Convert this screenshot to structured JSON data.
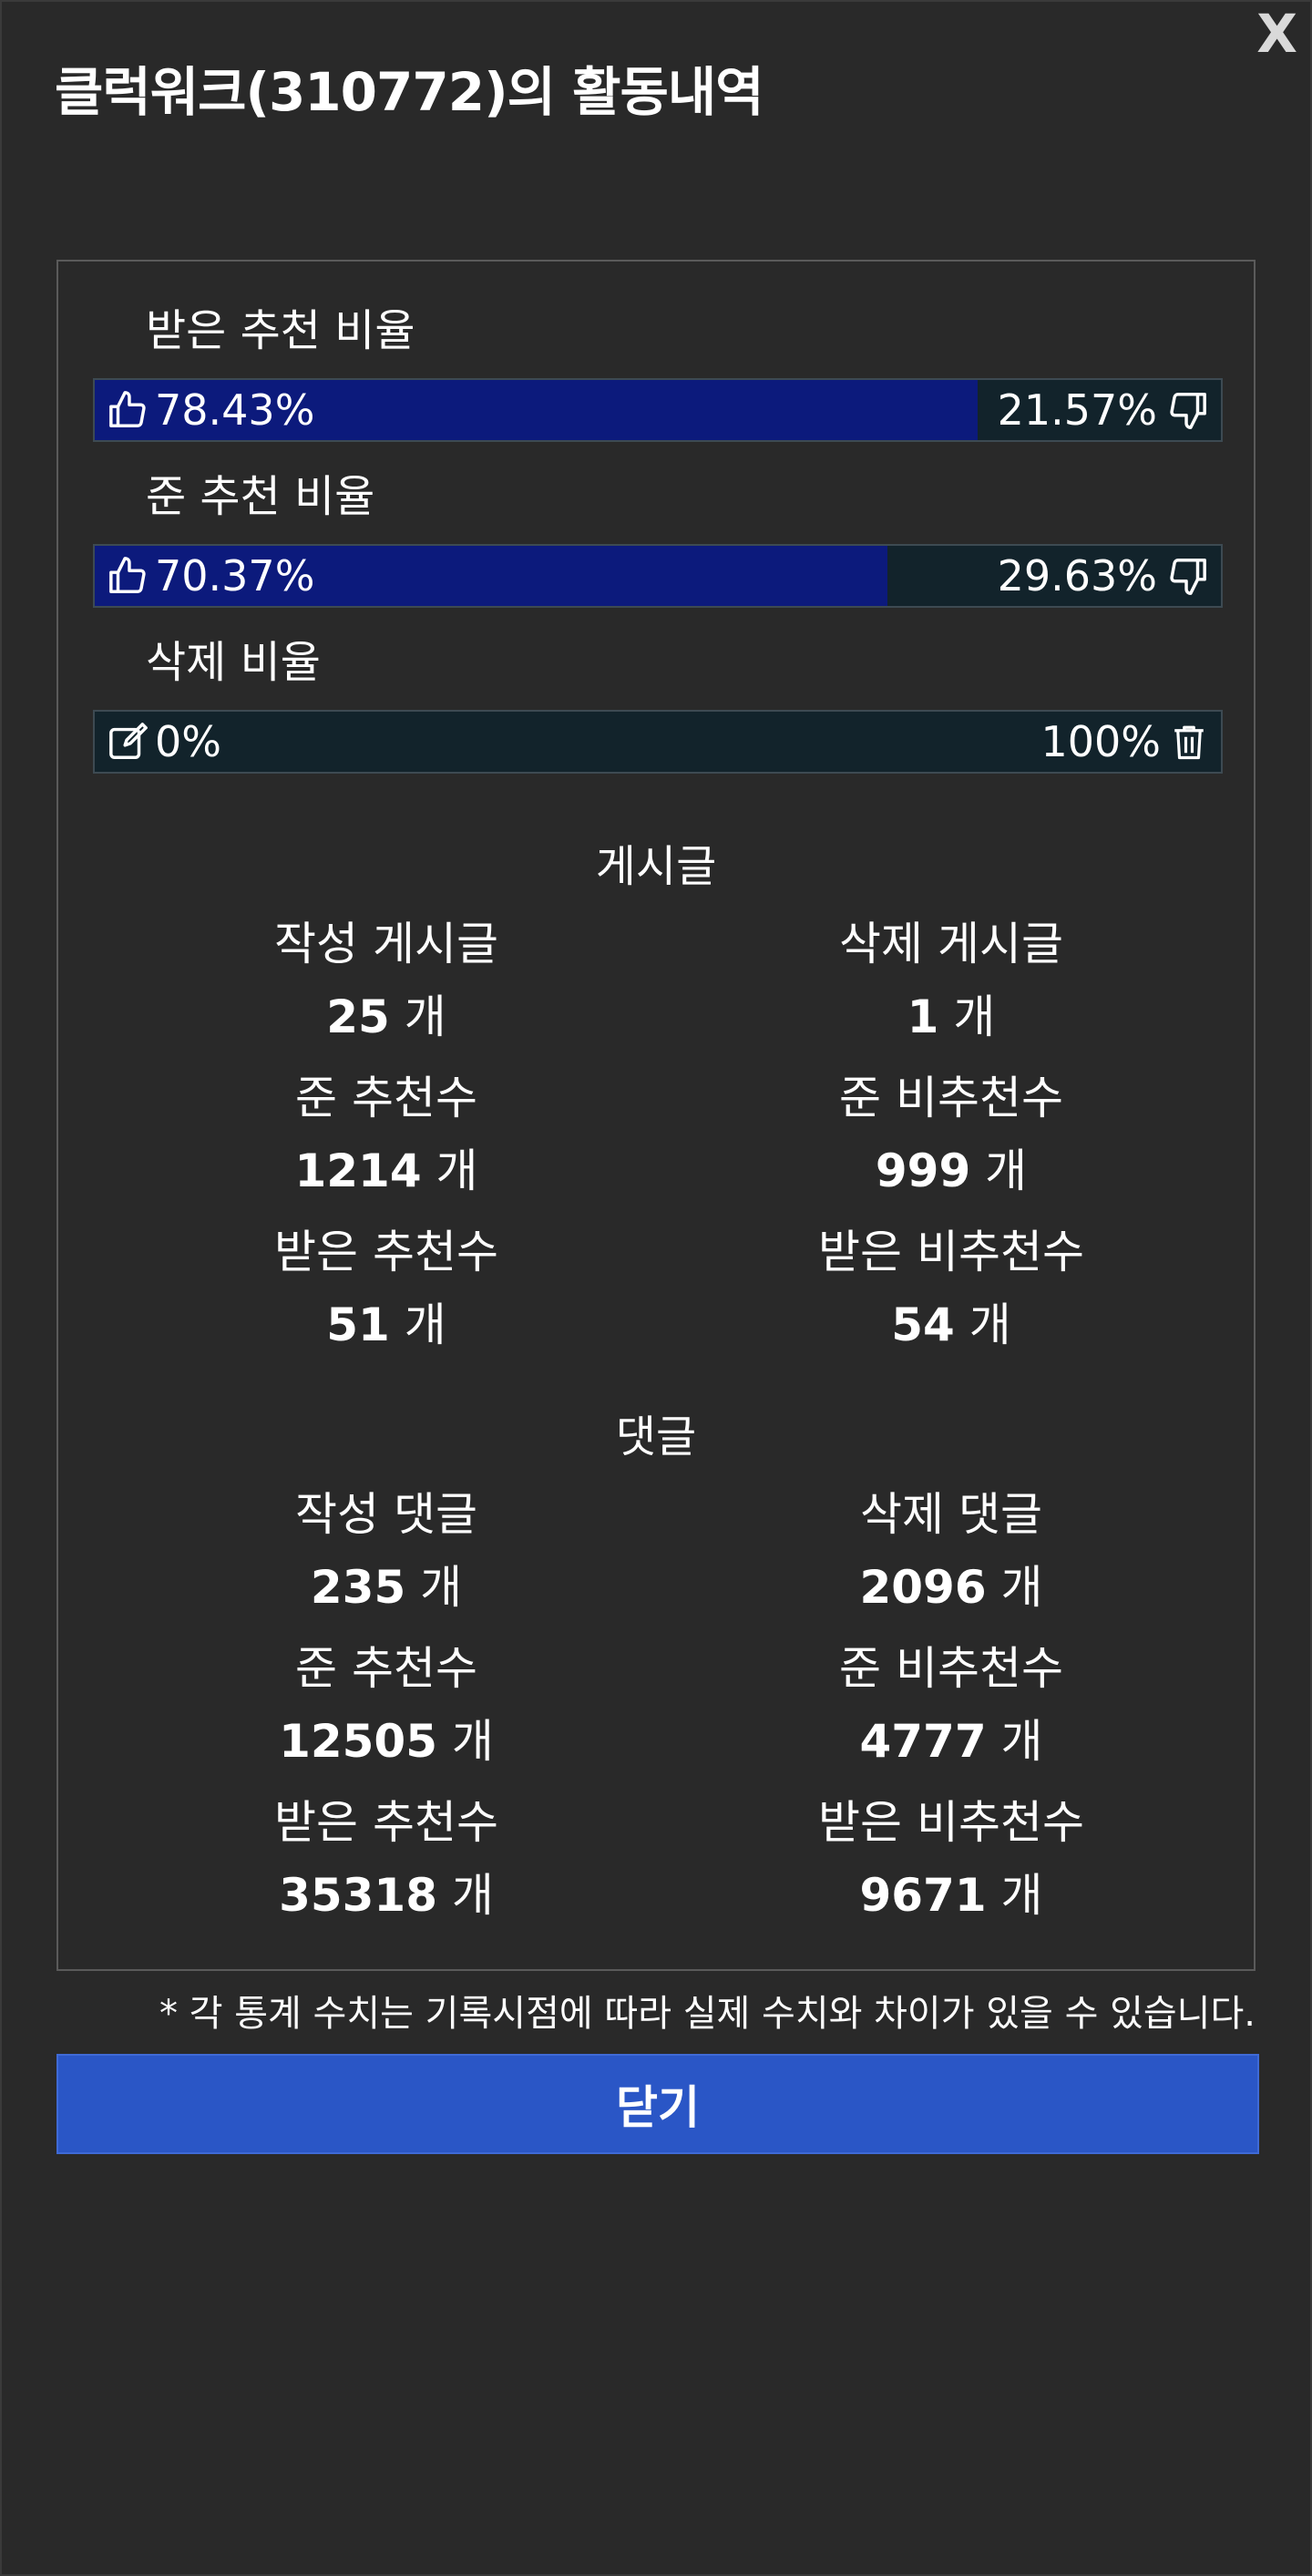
{
  "modal": {
    "title": "클럭워크(310772)의 활동내역",
    "close_x": "X"
  },
  "ratios": [
    {
      "label": "받은 추천 비율",
      "left_icon": "thumbs-up-icon",
      "left_value": "78.43%",
      "right_value": "21.57%",
      "right_icon": "thumbs-down-icon",
      "fill_fraction": 0.7843
    },
    {
      "label": "준 추천 비율",
      "left_icon": "thumbs-up-icon",
      "left_value": "70.37%",
      "right_value": "29.63%",
      "right_icon": "thumbs-down-icon",
      "fill_fraction": 0.7037
    },
    {
      "label": "삭제 비율",
      "left_icon": "edit-icon",
      "left_value": "0%",
      "right_value": "100%",
      "right_icon": "trash-icon",
      "fill_fraction": 0
    }
  ],
  "posts": {
    "title": "게시글",
    "stats": [
      {
        "label": "작성 게시글",
        "value": "25",
        "unit": "개"
      },
      {
        "label": "삭제 게시글",
        "value": "1",
        "unit": "개"
      },
      {
        "label": "준 추천수",
        "value": "1214",
        "unit": "개"
      },
      {
        "label": "준 비추천수",
        "value": "999",
        "unit": "개"
      },
      {
        "label": "받은 추천수",
        "value": "51",
        "unit": "개"
      },
      {
        "label": "받은 비추천수",
        "value": "54",
        "unit": "개"
      }
    ]
  },
  "comments": {
    "title": "댓글",
    "stats": [
      {
        "label": "작성 댓글",
        "value": "235",
        "unit": "개"
      },
      {
        "label": "삭제 댓글",
        "value": "2096",
        "unit": "개"
      },
      {
        "label": "준 추천수",
        "value": "12505",
        "unit": "개"
      },
      {
        "label": "준 비추천수",
        "value": "4777",
        "unit": "개"
      },
      {
        "label": "받은 추천수",
        "value": "35318",
        "unit": "개"
      },
      {
        "label": "받은 비추천수",
        "value": "9671",
        "unit": "개"
      }
    ]
  },
  "note": "* 각 통계 수치는 기록시점에 따라 실제 수치와 차이가 있을 수 있습니다.",
  "close_button": "닫기",
  "colors": {
    "background": "#292929",
    "bar_fill": "#0c1a7c",
    "bar_track": "#12232b",
    "button": "#2a56c6"
  }
}
